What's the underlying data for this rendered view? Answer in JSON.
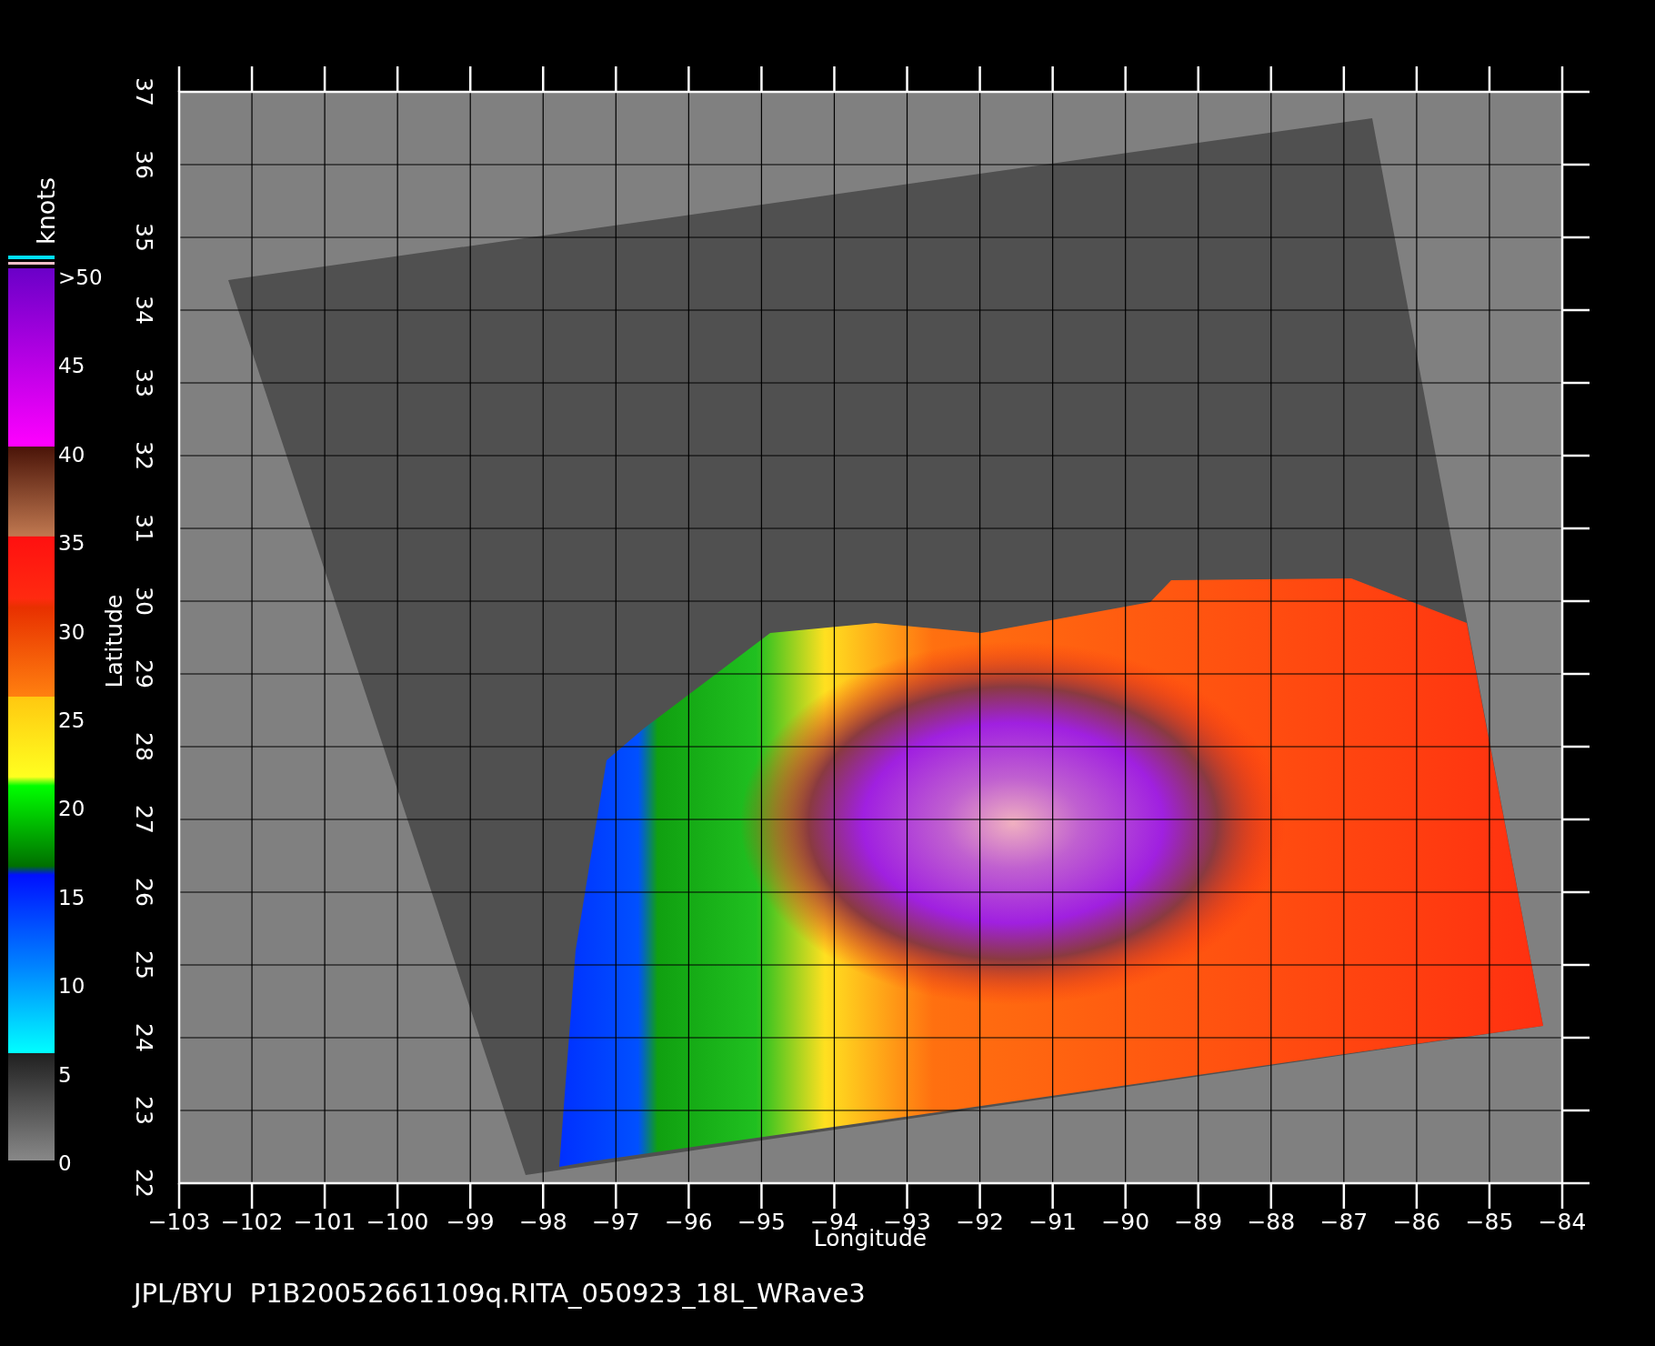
{
  "colorbar": {
    "title": "knots",
    "labels": [
      ">50",
      "45",
      "40",
      "35",
      "30",
      "25",
      "20",
      "15",
      "10",
      "5",
      "0"
    ]
  },
  "map": {
    "xlabel": "Longitude",
    "ylabel": "Latitude",
    "xticks": [
      "−103",
      "−102",
      "−101",
      "−100",
      "−99",
      "−98",
      "−97",
      "−96",
      "−95",
      "−94",
      "−93",
      "−92",
      "−91",
      "−90",
      "−89",
      "−88",
      "−87",
      "−86",
      "−85",
      "−84"
    ],
    "yticks": [
      "22",
      "23",
      "24",
      "25",
      "26",
      "27",
      "28",
      "29",
      "30",
      "31",
      "32",
      "33",
      "34",
      "35",
      "36",
      "37"
    ]
  },
  "caption": "JPL/BYU  P1B20052661109q.RITA_050923_18L_WRave3"
}
